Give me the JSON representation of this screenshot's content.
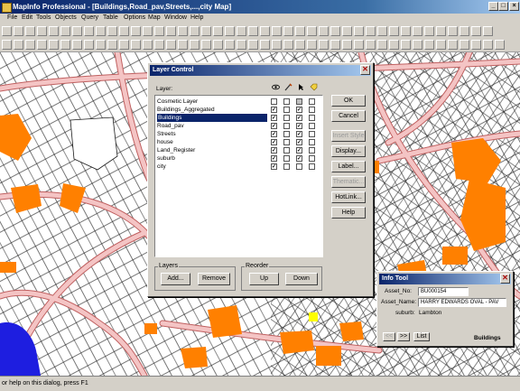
{
  "window": {
    "title": "MapInfo Professional - [Buildings,Road_pav,Streets,...,city Map]"
  },
  "menu": [
    "File",
    "Edit",
    "Tools",
    "Objects",
    "Query",
    "Table",
    "Options",
    "Map",
    "Window",
    "Help"
  ],
  "status_text": "or help on this dialog, press F1",
  "layer_control": {
    "title": "Layer Control",
    "layer_header": "Layer:",
    "column_icons": [
      "eye-icon",
      "pencil-icon",
      "cursor-icon",
      "label-icon"
    ],
    "layers": [
      {
        "name": "Cosmetic Layer",
        "visible": "",
        "editable": "",
        "selectable": "",
        "labels": ""
      },
      {
        "name": "Buildings_Aggregated",
        "visible": "✓",
        "editable": "",
        "selectable": "✓",
        "labels": ""
      },
      {
        "name": "Buildings",
        "visible": "✓",
        "editable": "",
        "selectable": "✓",
        "labels": ""
      },
      {
        "name": "Road_pav",
        "visible": "✓",
        "editable": "",
        "selectable": "✓",
        "labels": ""
      },
      {
        "name": "Streets",
        "visible": "✓",
        "editable": "",
        "selectable": "✓",
        "labels": ""
      },
      {
        "name": "house",
        "visible": "✓",
        "editable": "",
        "selectable": "✓",
        "labels": ""
      },
      {
        "name": "Land_Register",
        "visible": "✓",
        "editable": "",
        "selectable": "✓",
        "labels": ""
      },
      {
        "name": "suburb",
        "visible": "✓",
        "editable": "",
        "selectable": "✓",
        "labels": ""
      },
      {
        "name": "city",
        "visible": "✓",
        "editable": "",
        "selectable": "",
        "labels": ""
      }
    ],
    "selected_layer": "Buildings",
    "buttons": {
      "ok": "OK",
      "cancel": "Cancel",
      "insert_style": "Insert Style",
      "display": "Display...",
      "label": "Label...",
      "thematic": "Thematic...",
      "hotlink": "HotLink...",
      "help": "Help"
    },
    "layers_group": {
      "title": "Layers",
      "add": "Add...",
      "remove": "Remove"
    },
    "reorder_group": {
      "title": "Reorder",
      "up": "Up",
      "down": "Down"
    }
  },
  "info_tool": {
    "title": "Info Tool",
    "fields": [
      {
        "label": "Asset_No:",
        "value": "BU000154"
      },
      {
        "label": "Asset_Name:",
        "value": "HARRY EDWARDS OVAL - PAV"
      },
      {
        "label": "suburb:",
        "value": "Lambton"
      }
    ],
    "prev_label": "<<",
    "next_label": ">>",
    "list_label": "List",
    "table_name": "Buildings"
  },
  "colors": {
    "road": "#f4c4c4",
    "road_edge": "#c06060",
    "building": "#ff8000",
    "water": "#1e1ee0",
    "parcel": "#1a1a1a"
  }
}
